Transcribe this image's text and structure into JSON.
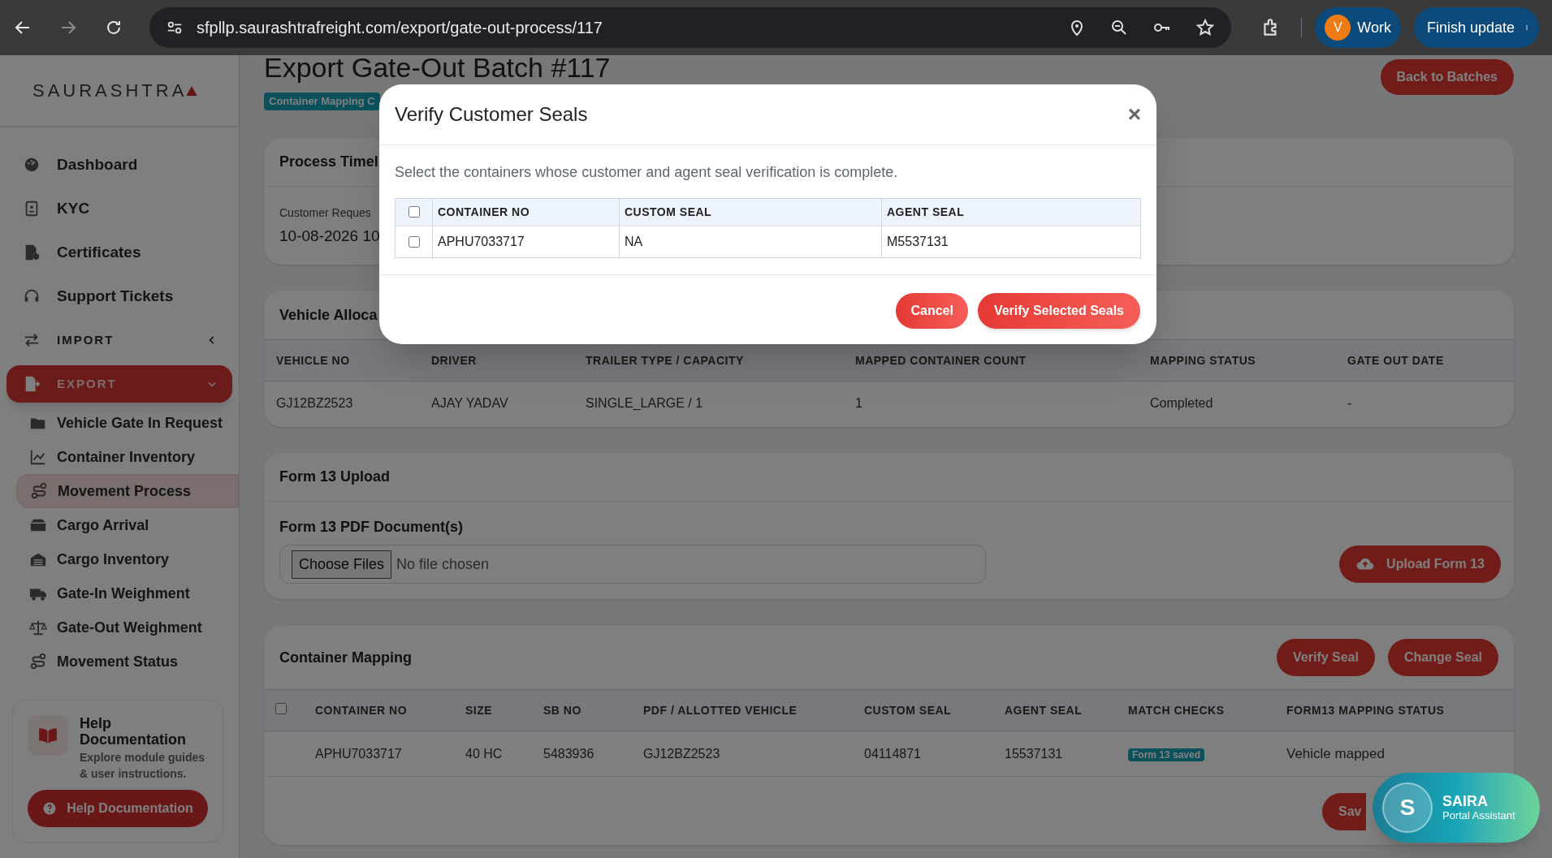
{
  "browser": {
    "url": "sfpllp.saurashtrafreight.com/export/gate-out-process/117",
    "profile_initial": "V",
    "profile": "Work",
    "update_button": "Finish update"
  },
  "sidebar": {
    "logo": "SAURASHTRA",
    "items": [
      {
        "kind": "link",
        "label": "Dashboard",
        "selected": false
      },
      {
        "kind": "link",
        "label": "KYC",
        "selected": false
      },
      {
        "kind": "link",
        "label": "Certificates",
        "selected": false
      },
      {
        "kind": "link",
        "label": "Support Tickets",
        "selected": false
      },
      {
        "kind": "section",
        "label": "IMPORT",
        "selected": false,
        "expanded": false
      },
      {
        "kind": "section",
        "label": "EXPORT",
        "selected": true,
        "expanded": true
      },
      {
        "kind": "sublink",
        "label": "Vehicle Gate In Request",
        "selected": false
      },
      {
        "kind": "sublink",
        "label": "Container Inventory",
        "selected": false
      },
      {
        "kind": "sublink",
        "label": "Movement Process",
        "selected": true
      },
      {
        "kind": "sublink",
        "label": "Cargo Arrival",
        "selected": false
      },
      {
        "kind": "sublink",
        "label": "Cargo Inventory",
        "selected": false
      },
      {
        "kind": "sublink",
        "label": "Gate-In Weighment",
        "selected": false
      },
      {
        "kind": "sublink",
        "label": "Gate-Out Weighment",
        "selected": false
      },
      {
        "kind": "sublink",
        "label": "Movement Status",
        "selected": false
      }
    ],
    "help": {
      "title": "Help Documentation",
      "text": "Explore module guides & user instructions.",
      "button": "Help Documentation"
    }
  },
  "page": {
    "title": "Export Gate-Out Batch #117",
    "badge": "Container Mapping C",
    "back_button": "Back to Batches"
  },
  "timeline": {
    "title": "Process Timel",
    "label": "Customer Reques",
    "value": "10-08-2026 10"
  },
  "vehicle_allocation": {
    "title": "Vehicle Alloca",
    "columns": [
      "VEHICLE NO",
      "DRIVER",
      "TRAILER TYPE / CAPACITY",
      "MAPPED CONTAINER COUNT",
      "MAPPING STATUS",
      "GATE OUT DATE"
    ],
    "rows": [
      [
        "GJ12BZ2523",
        "AJAY YADAV",
        "SINGLE_LARGE / 1",
        "1",
        "Completed",
        "-"
      ]
    ]
  },
  "form13": {
    "title": "Form 13 Upload",
    "field_label": "Form 13 PDF Document(s)",
    "choose_button": "Choose Files",
    "file_status": "No file chosen",
    "upload_button": "Upload Form 13"
  },
  "container_mapping": {
    "title": "Container Mapping",
    "buttons": [
      "Verify Seal",
      "Change Seal"
    ],
    "select_all_checked": false,
    "columns": [
      "CONTAINER NO",
      "SIZE",
      "SB NO",
      "PDF / ALLOTTED VEHICLE",
      "CUSTOM SEAL",
      "AGENT SEAL",
      "MATCH CHECKS",
      "FORM13 MAPPING STATUS"
    ],
    "rows": [
      {
        "cells": [
          "APHU7033717",
          "40 HC",
          "5483936",
          "GJ12BZ2523",
          "04114871",
          "15537131"
        ],
        "match_badge": "Form 13 saved",
        "status": "Vehicle mapped"
      }
    ],
    "save_button": "Sav"
  },
  "modal": {
    "title": "Verify Customer Seals",
    "close": "×",
    "description": "Select the containers whose customer and agent seal verification is complete.",
    "select_all_checked": false,
    "columns": [
      "CONTAINER NO",
      "CUSTOM SEAL",
      "AGENT SEAL"
    ],
    "rows": [
      {
        "checked": false,
        "cells": [
          "APHU7033717",
          "NA",
          "M5537131"
        ]
      }
    ],
    "buttons": [
      {
        "kind": "cancel",
        "label": "Cancel"
      },
      {
        "kind": "confirm",
        "label": "Verify Selected Seals"
      }
    ]
  },
  "assistant": {
    "initial": "S",
    "name": "SAIRA",
    "subtitle": "Portal Assistant"
  }
}
